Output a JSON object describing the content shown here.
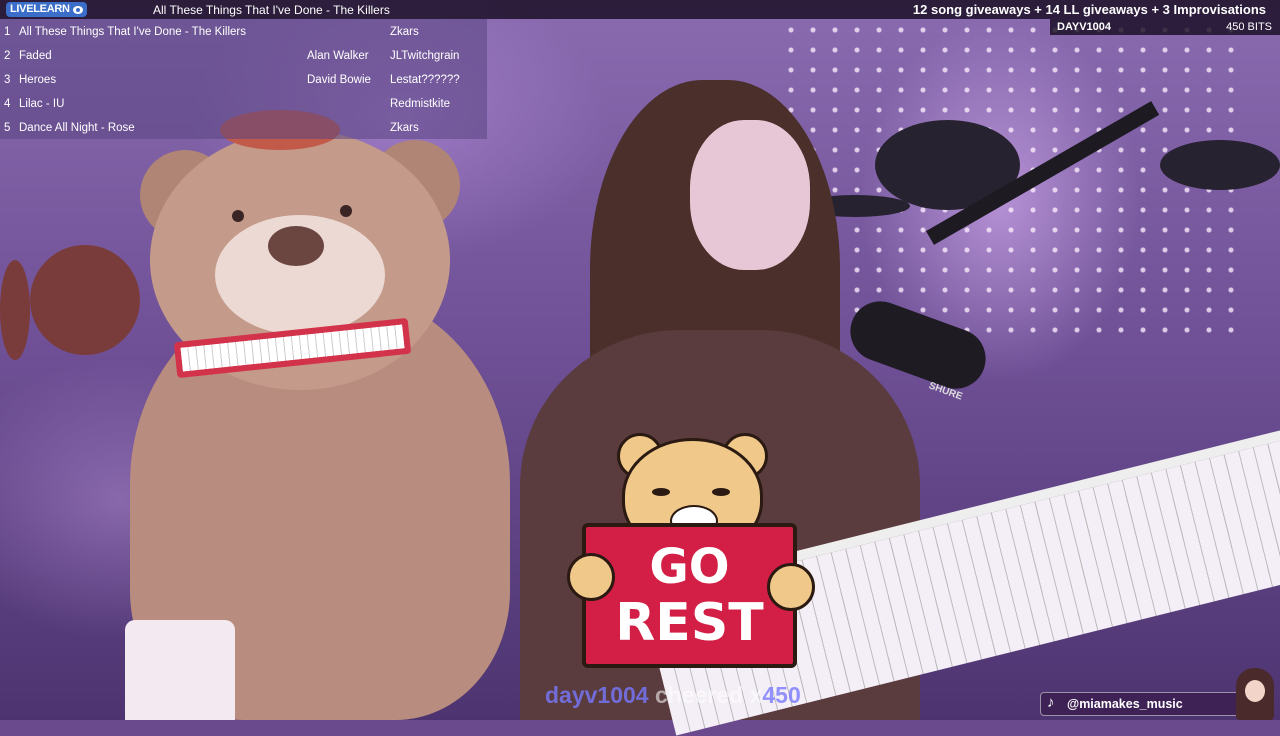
{
  "overlay": {
    "logo_text": "LIVELEARN",
    "now_playing": "All These Things That I've Done - The Killers",
    "giveaways": "12 song giveaways + 14 LL giveaways + 3 Improvisations",
    "latest_user": "DAYV1004",
    "latest_bits": "450 BITS"
  },
  "queue": [
    {
      "num": "1",
      "title": "All These Things That I've Done - The Killers",
      "artist": "",
      "requester": "Zkars"
    },
    {
      "num": "2",
      "title": "Faded",
      "artist": "Alan Walker",
      "requester": "JLTwitchgrain"
    },
    {
      "num": "3",
      "title": "Heroes",
      "artist": "David Bowie",
      "requester": "Lestat??????"
    },
    {
      "num": "4",
      "title": "Lilac - IU",
      "artist": "",
      "requester": "Redmistkite"
    },
    {
      "num": "5",
      "title": "Dance All Night - Rose",
      "artist": "",
      "requester": "Zkars"
    }
  ],
  "sticker": {
    "line1": "GO",
    "line2": "REST"
  },
  "cheer": {
    "name": "dayv1004",
    "verb": "cheered x",
    "amount": "450"
  },
  "social": {
    "handle": "@miamakes_music",
    "icon": "tiktok-icon"
  },
  "mic_brand": "SHURE",
  "colors": {
    "sign": "#d31f45",
    "logo": "#3a6ec9",
    "sticker_bear": "#f0c889"
  }
}
